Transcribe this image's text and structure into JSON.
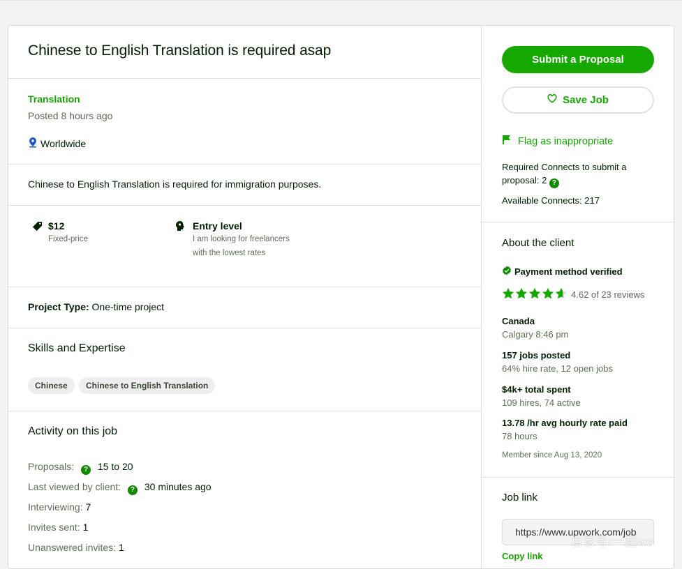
{
  "job": {
    "title": "Chinese to English Translation is required asap",
    "category": "Translation",
    "posted": "Posted 8 hours ago",
    "location": "Worldwide",
    "description": "Chinese to English Translation is required for immigration purposes.",
    "price": "$12",
    "price_type": "Fixed-price",
    "level": "Entry level",
    "level_desc_1": "I am looking for freelancers",
    "level_desc_2": "with the lowest rates",
    "project_type_label": "Project Type:",
    "project_type_value": "One-time project",
    "skills_title": "Skills and Expertise",
    "skills": [
      "Chinese",
      "Chinese to English Translation"
    ]
  },
  "activity": {
    "title": "Activity on this job",
    "proposals_label": "Proposals:",
    "proposals_value": "15 to 20",
    "last_viewed_label": "Last viewed by client:",
    "last_viewed_value": "30 minutes ago",
    "interviewing_label": "Interviewing:",
    "interviewing_value": "7",
    "invites_label": "Invites sent:",
    "invites_value": "1",
    "unanswered_label": "Unanswered invites:",
    "unanswered_value": "1"
  },
  "sidebar": {
    "submit_label": "Submit a Proposal",
    "save_label": "Save Job",
    "flag_label": "Flag as inappropriate",
    "connects_line1": "Required Connects to submit a",
    "connects_line2": "proposal: 2",
    "available_connects": "Available Connects: 217"
  },
  "client": {
    "title": "About the client",
    "payment": "Payment method verified",
    "rating": 4.62,
    "rating_text": "4.62 of 23 reviews",
    "country": "Canada",
    "city_time": "Calgary 8:46 pm",
    "jobs_posted": "157 jobs posted",
    "hire_rate": "64% hire rate, 12 open jobs",
    "spent": "$4k+ total spent",
    "hires": "109 hires, 74 active",
    "avg_rate": "13.78 /hr avg hourly rate paid",
    "hours": "78 hours",
    "member_since": "Member since Aug 13, 2020"
  },
  "joblink": {
    "title": "Job link",
    "url": "https://www.upwork.com/job",
    "copy_label": "Copy link"
  },
  "watermark": "百家号/一起wo",
  "colors": {
    "accent": "#14a800",
    "text": "#001e00",
    "muted": "#5e6d55"
  },
  "icons": [
    "location-pin-icon",
    "price-tag-icon",
    "brain-icon",
    "heart-icon",
    "flag-icon",
    "question-icon",
    "verified-icon",
    "star-icon"
  ]
}
